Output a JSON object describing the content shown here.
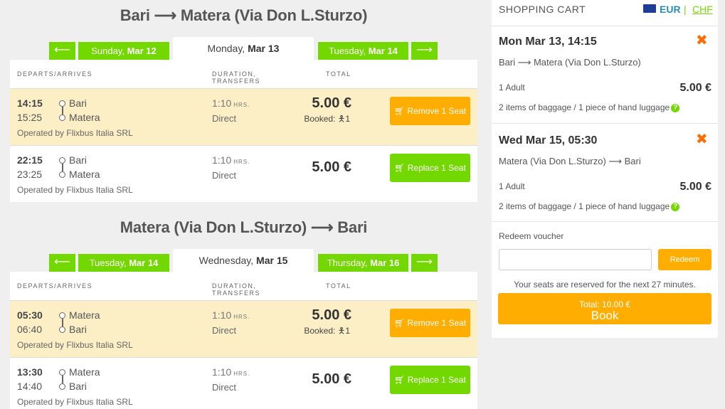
{
  "outbound": {
    "title": "Bari ⟶ Matera (Via Don L.Sturzo)",
    "prev_arrow": "⟵",
    "next_arrow": "⟶",
    "prev_day": "Sunday,",
    "prev_date": "Mar 12",
    "cur_day": "Monday,",
    "cur_date": "Mar 13",
    "next_day": "Tuesday,",
    "next_date": "Mar 14",
    "rows": [
      {
        "dep_time": "14:15",
        "arr_time": "15:25",
        "from": "Bari",
        "to": "Matera",
        "operator": "Operated by Flixbus Italia SRL",
        "duration": "1:10",
        "duration_unit": "HRS.",
        "transfers": "Direct",
        "price": "5.00 €",
        "booked": "Booked:",
        "booked_count": "1",
        "action": "Remove 1 Seat"
      },
      {
        "dep_time": "22:15",
        "arr_time": "23:25",
        "from": "Bari",
        "to": "Matera",
        "operator": "Operated by Flixbus Italia SRL",
        "duration": "1:10",
        "duration_unit": "HRS.",
        "transfers": "Direct",
        "price": "5.00 €",
        "action": "Replace 1 Seat"
      }
    ]
  },
  "return": {
    "title": "Matera (Via Don L.Sturzo) ⟶ Bari",
    "prev_arrow": "⟵",
    "next_arrow": "⟶",
    "prev_day": "Tuesday,",
    "prev_date": "Mar 14",
    "cur_day": "Wednesday,",
    "cur_date": "Mar 15",
    "next_day": "Thursday,",
    "next_date": "Mar 16",
    "rows": [
      {
        "dep_time": "05:30",
        "arr_time": "06:40",
        "from": "Matera",
        "to": "Bari",
        "operator": "Operated by Flixbus Italia SRL",
        "duration": "1:10",
        "duration_unit": "HRS.",
        "transfers": "Direct",
        "price": "5.00 €",
        "booked": "Booked:",
        "booked_count": "1",
        "action": "Remove 1 Seat"
      },
      {
        "dep_time": "13:30",
        "arr_time": "14:40",
        "from": "Matera",
        "to": "Bari",
        "operator": "Operated by Flixbus Italia SRL",
        "duration": "1:10",
        "duration_unit": "HRS.",
        "transfers": "Direct",
        "price": "5.00 €",
        "action": "Replace 1 Seat"
      }
    ]
  },
  "table_headers": {
    "departs": "DEPARTS/ARRIVES",
    "duration_1": "DURATION,",
    "duration_2": "TRANSFERS",
    "total": "TOTAL"
  },
  "cart": {
    "title": "SHOPPING CART",
    "currency_eur": "EUR",
    "separator": "|",
    "currency_chf": "CHF",
    "items": [
      {
        "heading": "Mon Mar 13, 14:15",
        "route": "Bari ⟶ Matera (Via Don L.Sturzo)",
        "passengers": "1 Adult",
        "price": "5.00 €",
        "baggage": "2 items of baggage / 1 piece of hand luggage"
      },
      {
        "heading": "Wed Mar 15, 05:30",
        "route": "Matera (Via Don L.Sturzo) ⟶ Bari",
        "passengers": "1 Adult",
        "price": "5.00 €",
        "baggage": "2 items of baggage / 1 piece of hand luggage"
      }
    ],
    "voucher_label": "Redeem voucher",
    "voucher_value": "",
    "redeem_label": "Redeem",
    "reservation_note": "Your seats are reserved for the next 27 minutes.",
    "total_label": "Total: 10.00 €",
    "book_label": "Book"
  },
  "colors": {
    "green": "#73d700",
    "orange": "#ffad00",
    "booked_bg": "#fcefc6",
    "remove_x": "#ff6c00"
  }
}
